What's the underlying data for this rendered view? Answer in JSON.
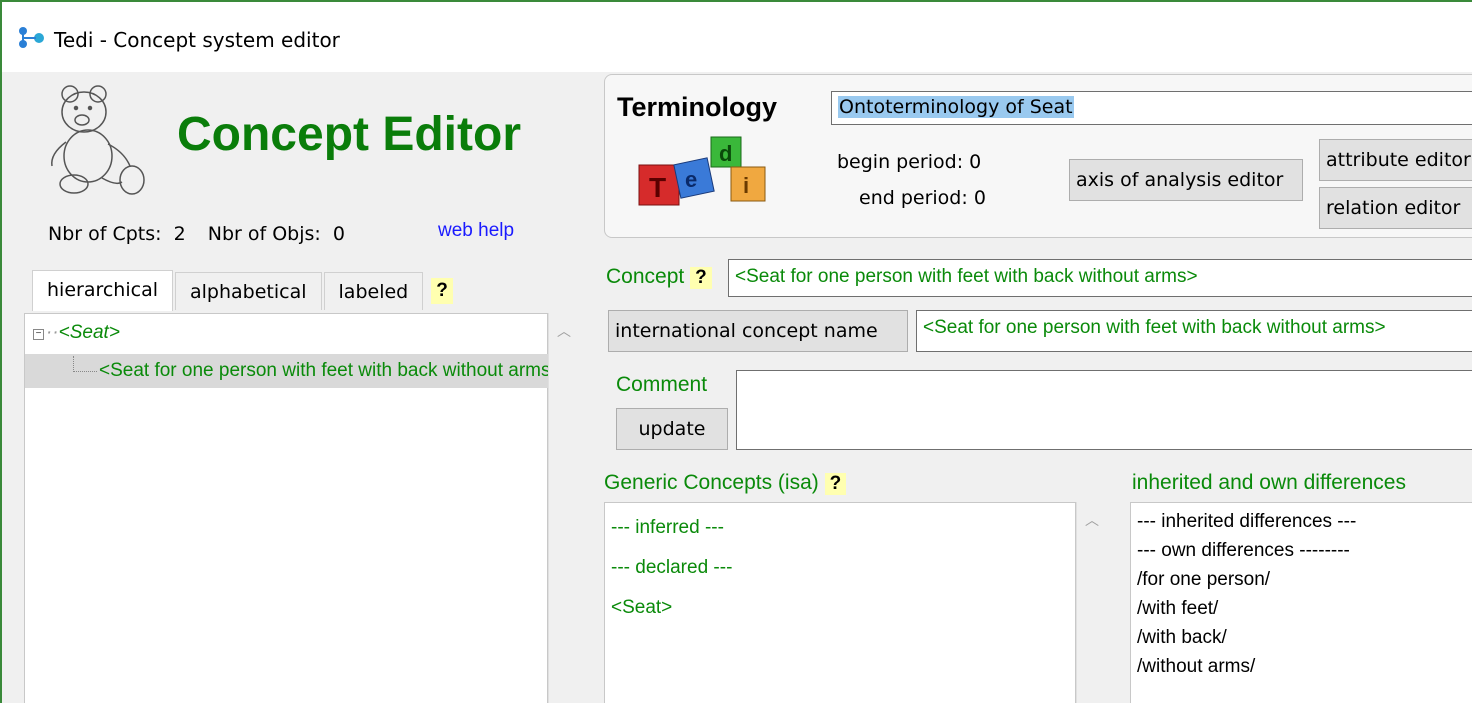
{
  "window": {
    "title": "Tedi - Concept system editor"
  },
  "header": {
    "app_title": "Concept Editor",
    "nbr_cpts_label": "Nbr of Cpts:",
    "nbr_cpts_value": "2",
    "nbr_objs_label": "Nbr of Objs:",
    "nbr_objs_value": "0",
    "web_help": "web help"
  },
  "tabs": [
    {
      "label": "hierarchical",
      "active": true
    },
    {
      "label": "alphabetical",
      "active": false
    },
    {
      "label": "labeled",
      "active": false
    }
  ],
  "help_mark": "?",
  "tree": {
    "root": "<Seat>",
    "child": "<Seat for one person with feet with back without arms>"
  },
  "terminology": {
    "label": "Terminology",
    "value": "Ontoterminology of Seat",
    "begin_period_label": "begin period:",
    "begin_period_value": "0",
    "end_period_label": "end period:",
    "end_period_value": "0",
    "axis_button": "axis of analysis editor",
    "attribute_button": "attribute editor",
    "relation_button": "relation editor"
  },
  "concept": {
    "label": "Concept",
    "value": "<Seat for one person with feet with back without arms>",
    "intl_button": "international concept name",
    "intl_value": "<Seat for one person with feet with back without arms>",
    "comment_label": "Comment",
    "comment_value": "",
    "update_button": "update"
  },
  "generic": {
    "label": "Generic Concepts (isa)",
    "lines": [
      "--- inferred  ---",
      "--- declared ---",
      "<Seat>"
    ]
  },
  "differences": {
    "label": "inherited and own differences",
    "lines": [
      "--- inherited differences ---",
      "--- own differences --------",
      "/for one person/",
      "/with feet/",
      "/with back/",
      "/without arms/"
    ]
  },
  "colors": {
    "green": "#0a8a0a",
    "link": "#1a1aff",
    "help_bg": "#ffffb0",
    "selection": "#99c9ef"
  }
}
